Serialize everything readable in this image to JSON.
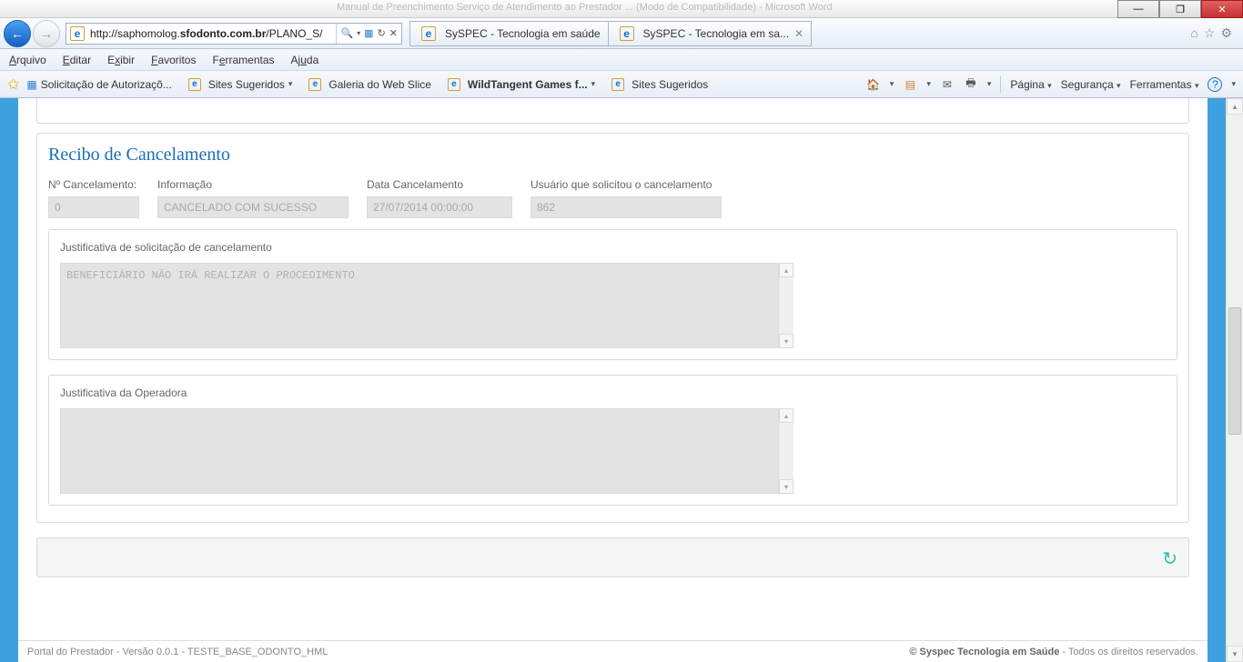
{
  "window": {
    "bg_title_1": "Manual de Preenchimento Serviço de Atendimento ao Prestador ... (Modo de Compatibilidade) - Microsoft Word",
    "bg_title_2": ""
  },
  "nav": {
    "url_prefix": "http://saphomolog.",
    "url_domain": "sfodonto.com.br",
    "url_suffix": "/PLANO_S/",
    "search_placeholder": "",
    "tabs": [
      {
        "title": "SySPEC - Tecnologia em saúde"
      },
      {
        "title": "SySPEC - Tecnologia em sa..."
      }
    ]
  },
  "menu": {
    "arquivo": "Arquivo",
    "editar": "Editar",
    "exibir": "Exibir",
    "favoritos": "Favoritos",
    "ferramentas": "Ferramentas",
    "ajuda": "Ajuda"
  },
  "favbar": {
    "items": [
      "Solicitação de Autorizaçõ...",
      "Sites Sugeridos",
      "Galeria do Web Slice",
      "WildTangent Games f...",
      "Sites Sugeridos"
    ]
  },
  "cmdbar": {
    "pagina": "Página",
    "seguranca": "Segurança",
    "ferramentas": "Ferramentas"
  },
  "page": {
    "title": "Recibo de Cancelamento",
    "fields": {
      "no_canc_label": "Nº Cancelamento:",
      "no_canc_value": "0",
      "informacao_label": "Informação",
      "informacao_value": "CANCELADO COM SUCESSO",
      "data_label": "Data Cancelamento",
      "data_value": "27/07/2014 00:00:00",
      "usuario_label": "Usuário que solicitou o cancelamento",
      "usuario_value": "862"
    },
    "just1_label": "Justificativa de solicitação de cancelamento",
    "just1_value": "BENEFICIÁRIO NÃO IRÁ REALIZAR O PROCEDIMENTO",
    "just2_label": "Justificativa da Operadora",
    "just2_value": ""
  },
  "footer": {
    "left": "Portal do Prestador - Versão 0.0.1 - TESTE_BASE_ODONTO_HML",
    "right_bold": "© Syspec Tecnologia em Saúde",
    "right_rest": " - Todos os direitos reservados."
  }
}
